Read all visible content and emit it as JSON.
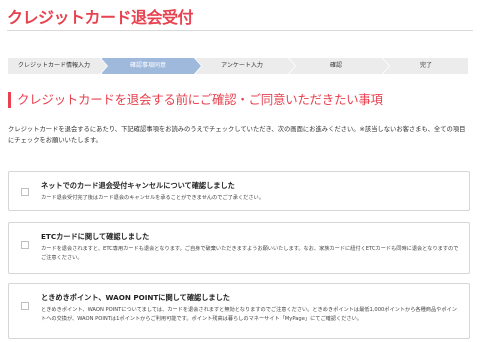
{
  "page": {
    "title": "クレジットカード退会受付"
  },
  "steps": [
    {
      "label": "クレジットカード情報入力",
      "active": false
    },
    {
      "label": "確認事項同意",
      "active": true
    },
    {
      "label": "アンケート入力",
      "active": false
    },
    {
      "label": "確認",
      "active": false
    },
    {
      "label": "完了",
      "active": false
    }
  ],
  "section": {
    "heading": "クレジットカードを退会する前にご確認・ご同意いただきたい事項",
    "intro": "クレジットカードを退会するにあたり、下記確認事項をお読みのうえでチェックしていただき、次の画面にお進みください。※該当しないお客さまも、全ての項目にチェックをお願いいたします。"
  },
  "cards": [
    {
      "title": "ネットでのカード退会受付キャンセルについて確認しました",
      "body": "カード退会受付完了後はカード退会のキャンセルを承ることができませんのでご了承ください。"
    },
    {
      "title": "ETCカードに関して確認しました",
      "body": "カードを退会されますと、ETC専用カードも退会となります。ご自身で破棄いただきますようお願いいたします。なお、家族カードに紐付くETCカードも同時に退会となりますのでご注意ください。"
    },
    {
      "title": "ときめきポイント、WAON POINTに関して確認しました",
      "body": "ときめきポイント、WAON POINTについてましては、カードを退会されますと無効となりますのでご注意ください。ときめきポイントは最低1,000ポイントから各種商品やポイントへの交換が、WAON POINTは1ポイントからご利用可能です。ポイント残高は暮らしのマネーサイト「MyPage」にてご確認ください。"
    }
  ]
}
